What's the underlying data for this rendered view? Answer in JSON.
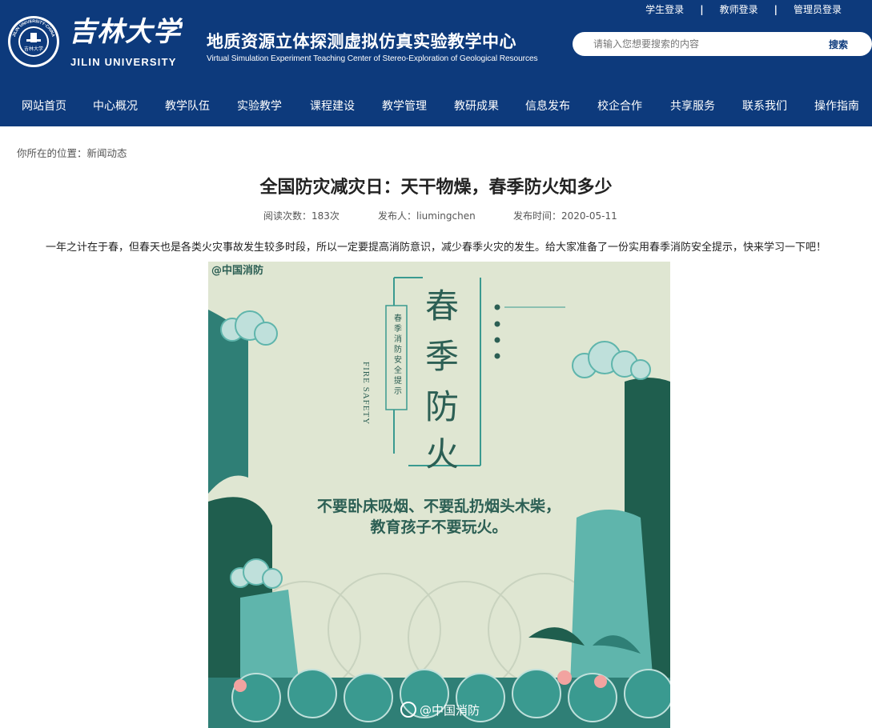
{
  "header": {
    "top_links": [
      "学生登录",
      "教师登录",
      "管理员登录"
    ],
    "logo_name": "吉林大学",
    "logo_en": "JILIN UNIVERSITY",
    "seal_text": "JILIN UNIVERSITY·CHINA",
    "center_title": "地质资源立体探测虚拟仿真实验教学中心",
    "center_subtitle": "Virtual Simulation Experiment Teaching Center of Stereo-Exploration of Geological Resources",
    "search_placeholder": "请输入您想要搜索的内容",
    "search_button": "搜索",
    "nav": [
      "网站首页",
      "中心概况",
      "教学队伍",
      "实验教学",
      "课程建设",
      "教学管理",
      "教研成果",
      "信息发布",
      "校企合作",
      "共享服务",
      "联系我们",
      "操作指南"
    ]
  },
  "breadcrumb": "你所在的位置：新闻动态",
  "article": {
    "title": "全国防灾减灾日：天干物燥，春季防火知多少",
    "reads": "阅读次数：183次",
    "author": "发布人：liumingchen",
    "date": "发布时间：2020-05-11",
    "intro": "一年之计在于春，但春天也是各类火灾事故发生较多时段，所以一定要提高消防意识，减少春季火灾的发生。给大家准备了一份实用春季消防安全提示，快来学习一下吧！"
  },
  "poster": {
    "watermark_top": "@中国消防",
    "big_title": [
      "春",
      "季",
      "防",
      "火"
    ],
    "side_text": "春季消防安全提示",
    "fire_safety": "FIRE SAFETY",
    "line1": "不要卧床吸烟、不要乱扔烟头木柴，",
    "line2": "教育孩子不要玩火。",
    "watermark_bottom": "@中国消防",
    "colors": {
      "background": "#dfe6d2",
      "teal": "#3a9a90",
      "dark_green": "#1f5e4e",
      "text": "#2c5f54"
    }
  }
}
